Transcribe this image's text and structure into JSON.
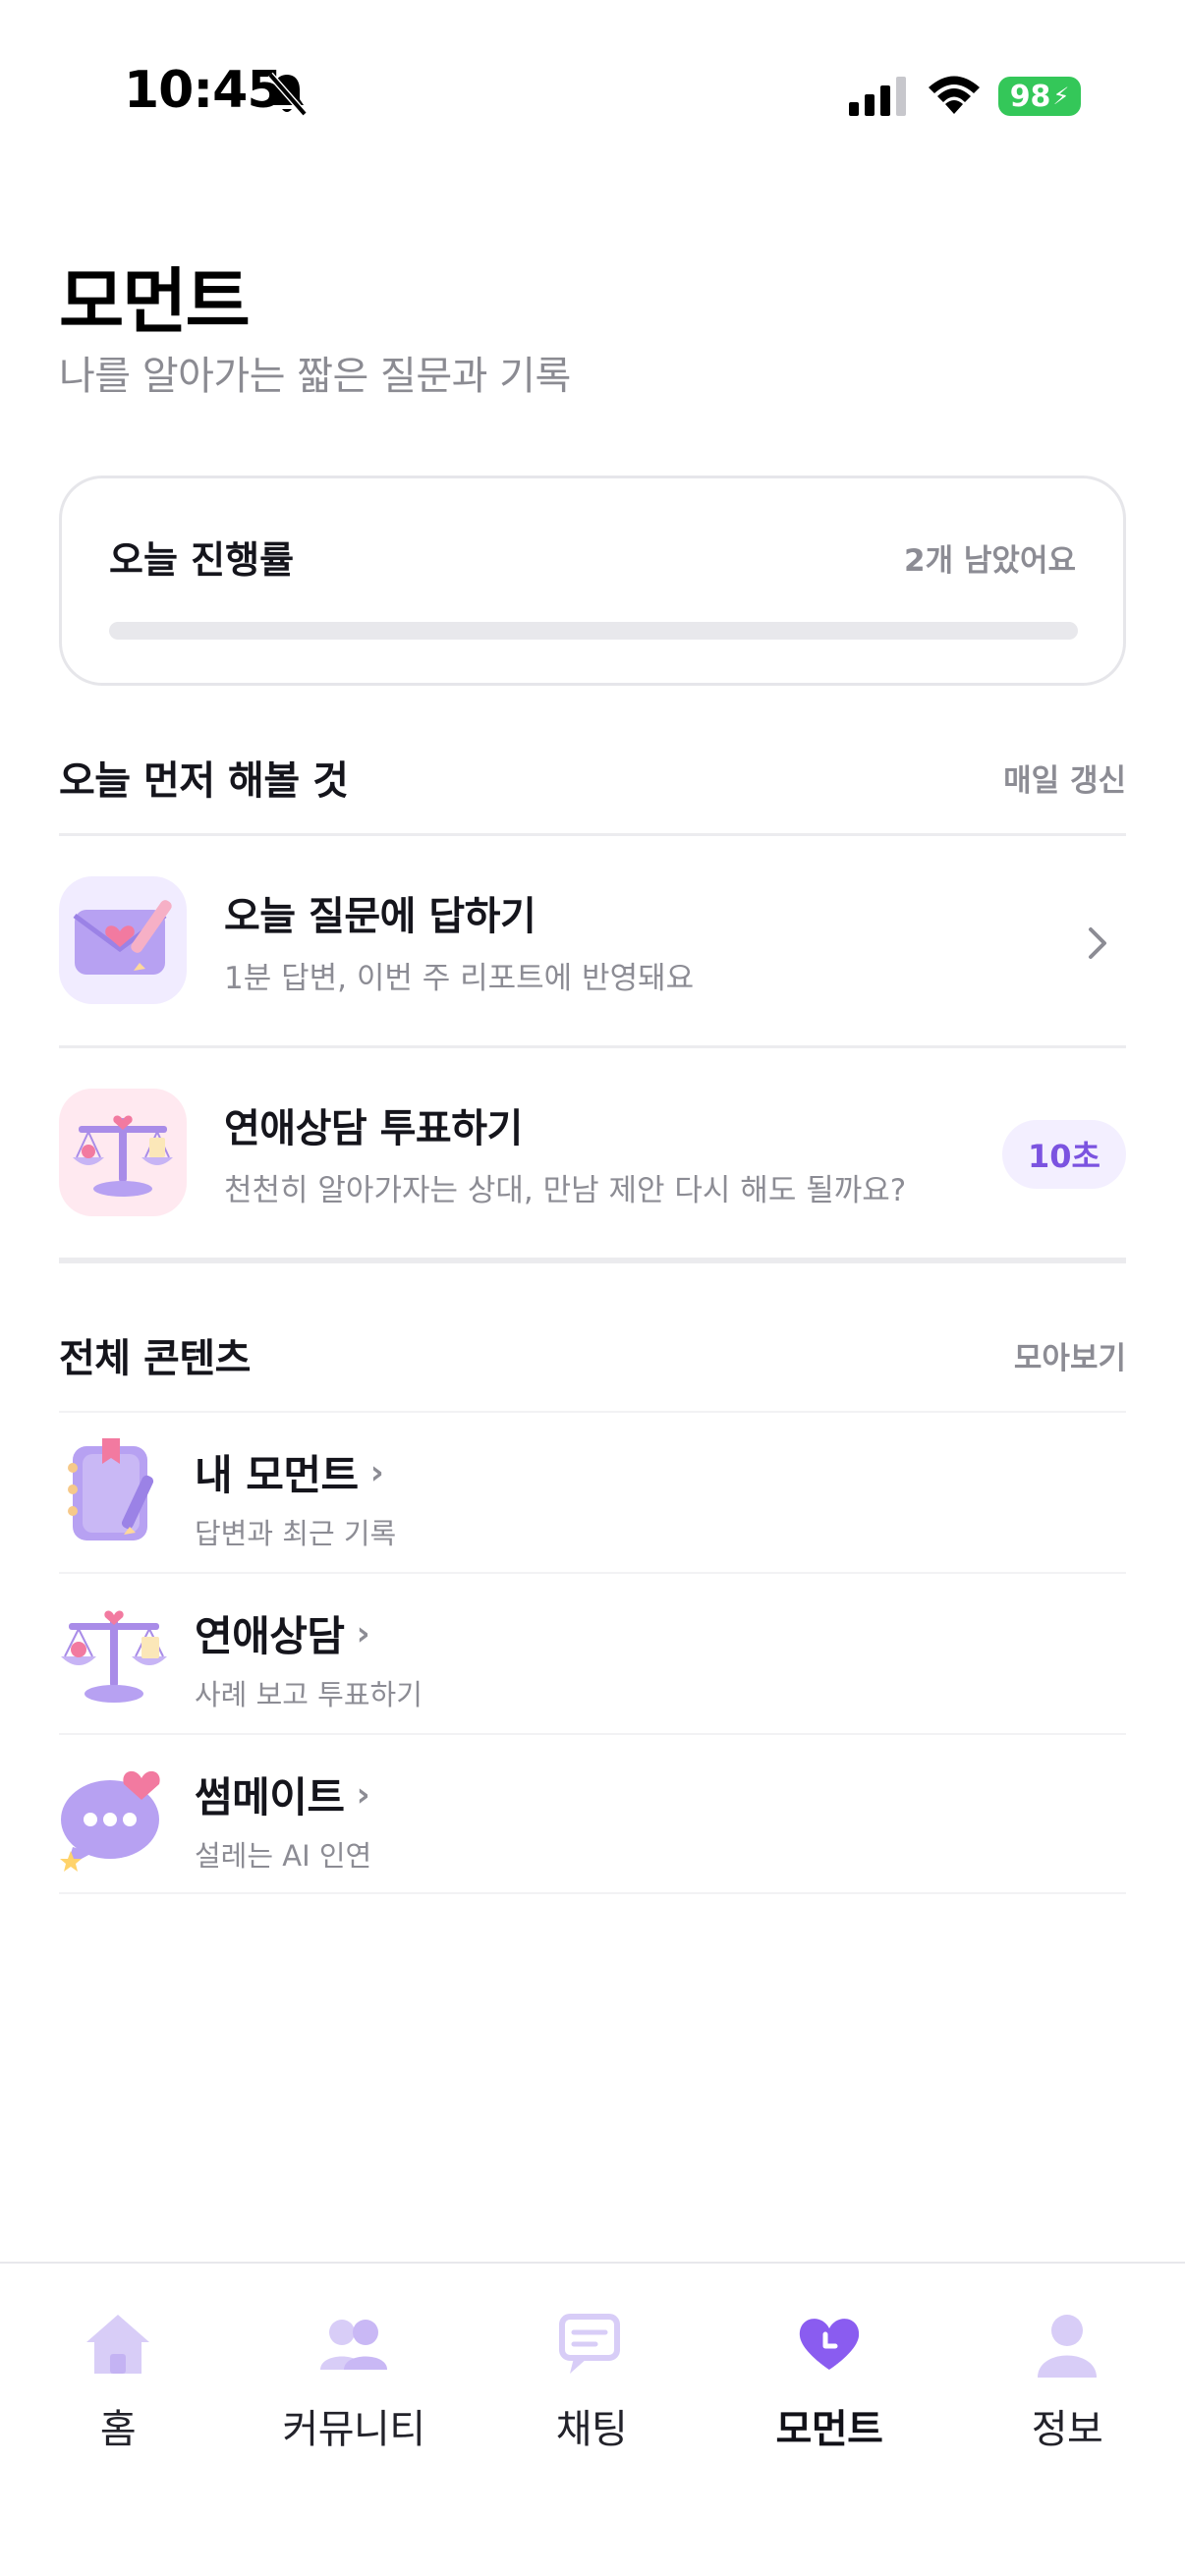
{
  "status_bar": {
    "time": "10:45",
    "battery": "98"
  },
  "header": {
    "title": "모먼트",
    "subtitle": "나를 알아가는 짧은 질문과 기록"
  },
  "progress": {
    "title": "오늘 진행률",
    "remaining": "2개 남았어요",
    "fraction": 0
  },
  "today_section": {
    "title": "오늘 먼저 해볼 것",
    "action": "매일 갱신",
    "tasks": [
      {
        "title": "오늘 질문에 답하기",
        "description": "1분 답변, 이번 주 리포트에 반영돼요",
        "icon": "love-letter-icon"
      },
      {
        "title": "연애상담 투표하기",
        "description": "천천히 알아가자는 상대, 만남 제안 다시 해도 될까요?",
        "badge": "10초",
        "icon": "scale-icon"
      }
    ]
  },
  "all_section": {
    "title": "전체 콘텐츠",
    "action": "모아보기",
    "items": [
      {
        "title": "내 모먼트",
        "description": "답변과 최근 기록",
        "icon": "notebook-icon"
      },
      {
        "title": "연애상담",
        "description": "사례 보고 투표하기",
        "icon": "scale-icon"
      },
      {
        "title": "썸메이트",
        "description": "설레는 AI 인연",
        "icon": "chat-bubble-heart-icon"
      }
    ]
  },
  "tab_bar": {
    "tabs": [
      {
        "label": "홈",
        "icon": "home-icon"
      },
      {
        "label": "커뮤니티",
        "icon": "people-icon"
      },
      {
        "label": "채팅",
        "icon": "chat-icon"
      },
      {
        "label": "모먼트",
        "icon": "heart-clock-icon",
        "active": true
      },
      {
        "label": "정보",
        "icon": "person-icon"
      }
    ]
  },
  "colors": {
    "accent": "#7b53e0",
    "accent_light": "#c9b8f5",
    "text_muted": "#8c8c94"
  }
}
